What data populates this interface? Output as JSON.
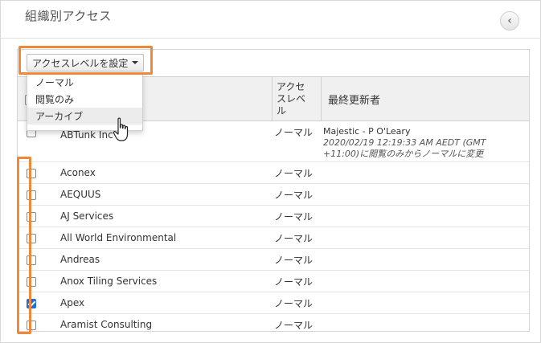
{
  "header": {
    "title": "組織別アクセス",
    "collapse_icon": "chevron-left-icon"
  },
  "toolbar": {
    "set_level_label": "アクセスレベルを設定",
    "caret_icon": "caret-down-icon"
  },
  "dropdown": {
    "options": [
      "ノーマル",
      "閲覧のみ",
      "アーカイブ"
    ],
    "hovered": "アーカイブ"
  },
  "table": {
    "columns": {
      "access": "アクセスレベル",
      "access_lines": [
        "アクセ",
        "スレベ",
        "ル"
      ],
      "updated": "最終更新者"
    },
    "first_row": {
      "name_partial": "ABTunk Inc",
      "access": "ノーマル",
      "updated_by": "Majestic - P O'Leary",
      "updated_detail_line1": "2020/02/19 12:19:33 AM AEDT (GMT",
      "updated_detail_line2": "+11:00)に閲覧のみからノーマルに変更"
    },
    "rows": [
      {
        "name": "Aconex",
        "access": "ノーマル",
        "checked": false
      },
      {
        "name": "AEQUUS",
        "access": "ノーマル",
        "checked": false
      },
      {
        "name": "AJ Services",
        "access": "ノーマル",
        "checked": false
      },
      {
        "name": "All World Environmental",
        "access": "ノーマル",
        "checked": false
      },
      {
        "name": "Andreas",
        "access": "ノーマル",
        "checked": false
      },
      {
        "name": "Anox Tiling Services",
        "access": "ノーマル",
        "checked": false
      },
      {
        "name": "Apex",
        "access": "ノーマル",
        "checked": true
      },
      {
        "name": "Aramist Consulting",
        "access": "ノーマル",
        "checked": false
      }
    ]
  },
  "colors": {
    "highlight": "#f0883a",
    "checkbox_checked": "#1e6fd9"
  }
}
